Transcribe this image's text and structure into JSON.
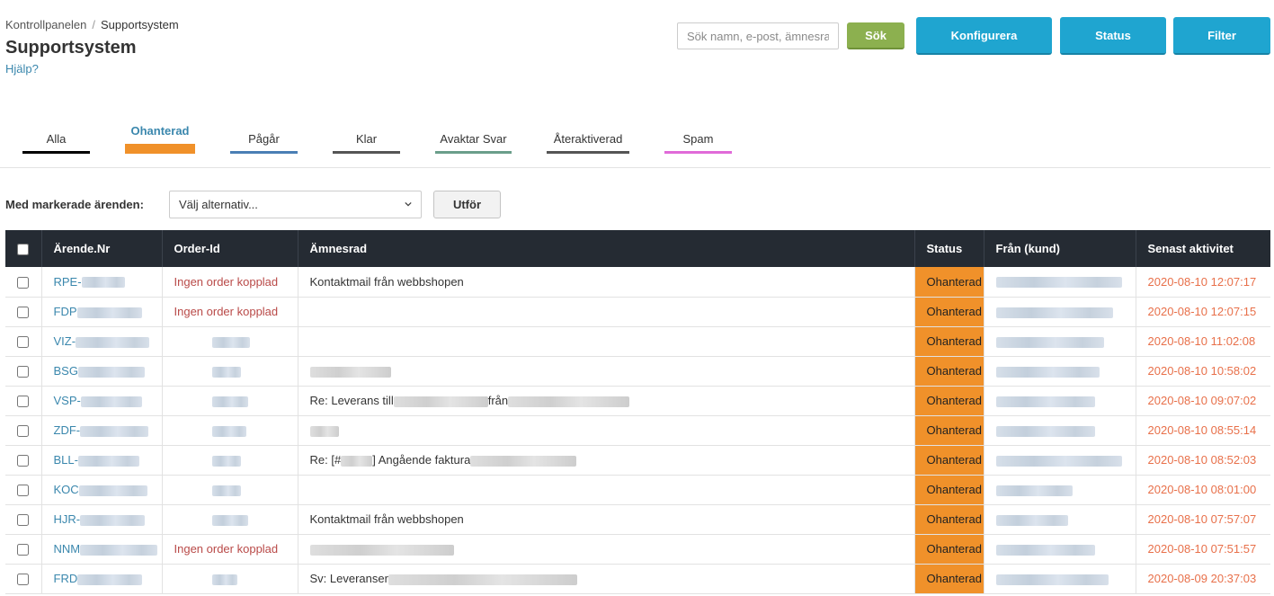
{
  "breadcrumb": {
    "root": "Kontrollpanelen",
    "separator": "/",
    "current": "Supportsystem"
  },
  "page": {
    "title": "Supportsystem",
    "help_link": "Hjälp?"
  },
  "header": {
    "search_placeholder": "Sök namn, e-post, ämnesrad",
    "search_button": "Sök",
    "configure_button": "Konfigurera",
    "status_button": "Status",
    "filter_button": "Filter"
  },
  "tabs": [
    {
      "label": "Alla",
      "color": "#000000",
      "active": false
    },
    {
      "label": "Ohanterad",
      "color": "#f0912a",
      "active": true
    },
    {
      "label": "Pågår",
      "color": "#4a7fb5",
      "active": false
    },
    {
      "label": "Klar",
      "color": "#555555",
      "active": false
    },
    {
      "label": "Avaktar Svar",
      "color": "#6a9e8a",
      "active": false
    },
    {
      "label": "Återaktiverad",
      "color": "#555555",
      "active": false
    },
    {
      "label": "Spam",
      "color": "#e06ad8",
      "active": false
    }
  ],
  "bulk": {
    "label": "Med markerade ärenden:",
    "select_placeholder": "Välj alternativ...",
    "apply_button": "Utför"
  },
  "table": {
    "columns": [
      "Ärende.Nr",
      "Order-Id",
      "Ämnesrad",
      "Status",
      "Från (kund)",
      "Senast aktivitet"
    ],
    "rows": [
      {
        "ticket_prefix": "RPE-",
        "order": "Ingen order kopplad",
        "subject_parts": [
          "Kontaktmail från webbshopen"
        ],
        "status": "Ohanterad",
        "last_activity": "2020-08-10 12:07:17"
      },
      {
        "ticket_prefix": "FDP",
        "order": "Ingen order kopplad",
        "subject_parts": [],
        "status": "Ohanterad",
        "last_activity": "2020-08-10 12:07:15"
      },
      {
        "ticket_prefix": "VIZ-",
        "order": "",
        "subject_parts": [],
        "status": "Ohanterad",
        "last_activity": "2020-08-10 11:02:08"
      },
      {
        "ticket_prefix": "BSG",
        "order": "",
        "subject_parts": [],
        "status": "Ohanterad",
        "last_activity": "2020-08-10 10:58:02"
      },
      {
        "ticket_prefix": "VSP-",
        "order": "",
        "subject_parts": [
          "Re: Leverans till",
          "från"
        ],
        "status": "Ohanterad",
        "last_activity": "2020-08-10 09:07:02"
      },
      {
        "ticket_prefix": "ZDF-",
        "order": "",
        "subject_parts": [],
        "status": "Ohanterad",
        "last_activity": "2020-08-10 08:55:14"
      },
      {
        "ticket_prefix": "BLL-",
        "order": "",
        "subject_parts": [
          "Re: [#",
          "] Angående faktura"
        ],
        "status": "Ohanterad",
        "last_activity": "2020-08-10 08:52:03"
      },
      {
        "ticket_prefix": "KOC",
        "order": "",
        "subject_parts": [],
        "status": "Ohanterad",
        "last_activity": "2020-08-10 08:01:00"
      },
      {
        "ticket_prefix": "HJR-",
        "order": "",
        "subject_parts": [
          "Kontaktmail från webbshopen"
        ],
        "status": "Ohanterad",
        "last_activity": "2020-08-10 07:57:07"
      },
      {
        "ticket_prefix": "NNM",
        "order": "Ingen order kopplad",
        "subject_parts": [],
        "status": "Ohanterad",
        "last_activity": "2020-08-10 07:51:57"
      },
      {
        "ticket_prefix": "FRD",
        "order": "",
        "subject_parts": [
          "Sv: Leveranser"
        ],
        "status": "Ohanterad",
        "last_activity": "2020-08-09 20:37:03"
      }
    ]
  }
}
